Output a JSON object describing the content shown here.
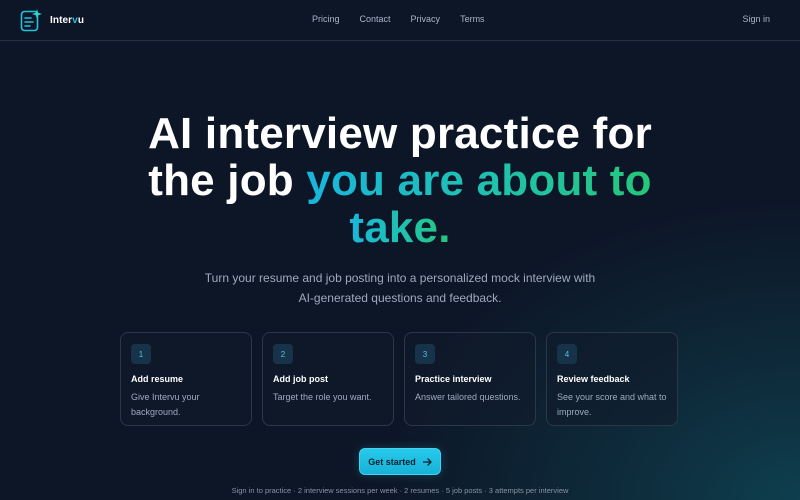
{
  "brand": {
    "name_prefix": "Inter",
    "name_accent": "v",
    "name_suffix": "u",
    "icon": "document-sparkle-icon"
  },
  "nav": {
    "items": [
      "Pricing",
      "Contact",
      "Privacy",
      "Terms"
    ],
    "signin": "Sign in"
  },
  "hero": {
    "line1": "AI interview practice for",
    "line2_plain": "the job ",
    "line2_accent": "you are about to",
    "line3_accent": "take."
  },
  "subtitle": "Turn your resume and job posting into a personalized mock interview with AI-generated questions and feedback.",
  "steps": [
    {
      "num": "1",
      "title": "Add resume",
      "desc": "Give Intervu your background."
    },
    {
      "num": "2",
      "title": "Add job post",
      "desc": "Target the role you want."
    },
    {
      "num": "3",
      "title": "Practice interview",
      "desc": "Answer tailored questions."
    },
    {
      "num": "4",
      "title": "Review feedback",
      "desc": "See your score and what to improve."
    }
  ],
  "cta": {
    "label": "Get started",
    "icon": "arrow-right-icon"
  },
  "footnote": "Sign in to practice · 2 interview sessions per week · 2 resumes · 5 job posts · 3 attempts per interview",
  "colors": {
    "accent": "#22c1dd",
    "accent_green": "#26c77a",
    "background": "#0d1627"
  }
}
